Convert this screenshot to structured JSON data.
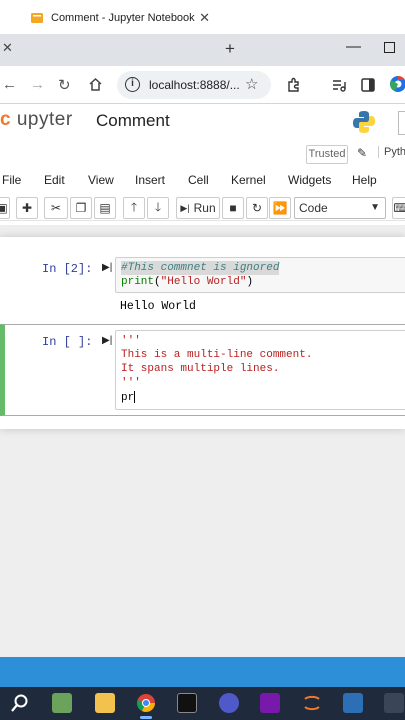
{
  "browser": {
    "tab_title": "Comment - Jupyter Notebook",
    "url": "localhost:8888/...",
    "new_tab": "+",
    "close_glyph": "✕"
  },
  "jupyter": {
    "logo_text": "upyter",
    "notebook_name": "Comment",
    "trusted": "Trusted",
    "kernel": "Pyth"
  },
  "menu": [
    "File",
    "Edit",
    "View",
    "Insert",
    "Cell",
    "Kernel",
    "Widgets",
    "Help"
  ],
  "toolbar": {
    "run_label": "Run",
    "cell_type": "Code"
  },
  "cells": [
    {
      "prompt": "In [2]:",
      "lines": [
        "#This commnet is ignored",
        "print(\"Hello World\")"
      ],
      "output": "Hello World"
    },
    {
      "prompt": "In [ ]:",
      "lines": [
        "'''",
        "This is a multi-line comment.",
        "It spans multiple lines.",
        "'''",
        "pr"
      ]
    }
  ],
  "colors": {
    "accent_orange": "#f37726",
    "selected_cell_border": "#66bb6a",
    "taskbar": "#1f2b3c"
  }
}
